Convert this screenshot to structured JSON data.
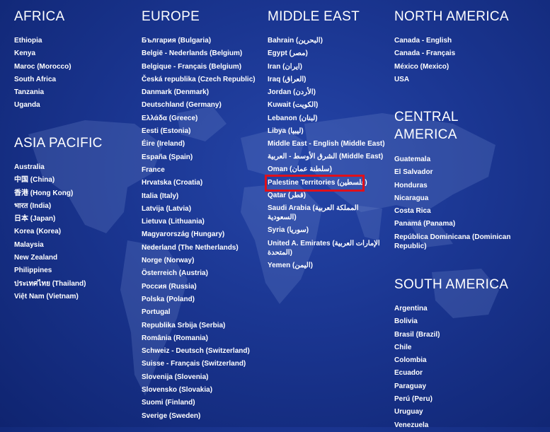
{
  "regions": {
    "africa": {
      "heading": "AFRICA",
      "items": [
        "Ethiopia",
        "Kenya",
        "Maroc (Morocco)",
        "South Africa",
        "Tanzania",
        "Uganda"
      ]
    },
    "asia_pacific": {
      "heading": "ASIA PACIFIC",
      "items": [
        "Australia",
        "中国 (China)",
        "香港 (Hong Kong)",
        "भारत (India)",
        "日本 (Japan)",
        "Korea (Korea)",
        "Malaysia",
        "New Zealand",
        "Philippines",
        "ประเทศไทย (Thailand)",
        "Việt Nam (Vietnam)"
      ]
    },
    "europe": {
      "heading": "EUROPE",
      "items": [
        "България (Bulgaria)",
        "België - Nederlands (Belgium)",
        "Belgique - Français (Belgium)",
        "Česká republika (Czech Republic)",
        "Danmark (Denmark)",
        "Deutschland (Germany)",
        "Ελλάδα (Greece)",
        "Eesti (Estonia)",
        "Éire (Ireland)",
        "España (Spain)",
        "France",
        "Hrvatska (Croatia)",
        "Italia (Italy)",
        "Latvija (Latvia)",
        "Lietuva (Lithuania)",
        "Magyarország (Hungary)",
        "Nederland (The Netherlands)",
        "Norge (Norway)",
        "Österreich (Austria)",
        "Россия (Russia)",
        "Polska (Poland)",
        "Portugal",
        "Republika Srbija (Serbia)",
        "România (Romania)",
        "Schweiz - Deutsch (Switzerland)",
        "Suisse - Français (Switzerland)",
        "Slovenija (Slovenia)",
        "Slovensko (Slovakia)",
        "Suomi (Finland)",
        "Sverige (Sweden)"
      ]
    },
    "middle_east": {
      "heading": "MIDDLE EAST",
      "items": [
        "Bahrain (البحرين)",
        "Egypt (مصر)",
        "Iran (ایران)",
        "Iraq (العراق)",
        "Jordan (الأردن)",
        "Kuwait (الكويت)",
        "Lebanon (لبنان)",
        "Libya (ليبيا)",
        "Middle East - English (Middle East)",
        "الشرق الأوسط - العربية (Middle East)",
        "Oman (سلطنة عمان)",
        "Palestine Territories (فلسطين)",
        "Qatar (قطر)",
        "Saudi Arabia (المملكة العربية السعودية)",
        "Syria (سوريا)",
        "United A. Emirates (الإمارات العربية المتحدة)",
        "Yemen (اليمن)"
      ],
      "highlighted": "Palestine Territories (فلسطين)"
    },
    "north_america": {
      "heading": "NORTH AMERICA",
      "items": [
        "Canada - English",
        "Canada - Français",
        "México (Mexico)",
        "USA"
      ]
    },
    "central_america": {
      "heading": "CENTRAL AMERICA",
      "items": [
        "Guatemala",
        "El Salvador",
        "Honduras",
        "Nicaragua",
        "Costa Rica",
        "Panamá (Panama)",
        "República Dominicana (Dominican Republic)"
      ]
    },
    "south_america": {
      "heading": "SOUTH AMERICA",
      "items": [
        "Argentina",
        "Bolivia",
        "Brasil (Brazil)",
        "Chile",
        "Colombia",
        "Ecuador",
        "Paraguay",
        "Perú (Peru)",
        "Uruguay",
        "Venezuela"
      ]
    }
  },
  "colors": {
    "background": "#1a3590",
    "text": "#ffffff",
    "highlight": "#e0101a",
    "map": "#6d86c8"
  }
}
